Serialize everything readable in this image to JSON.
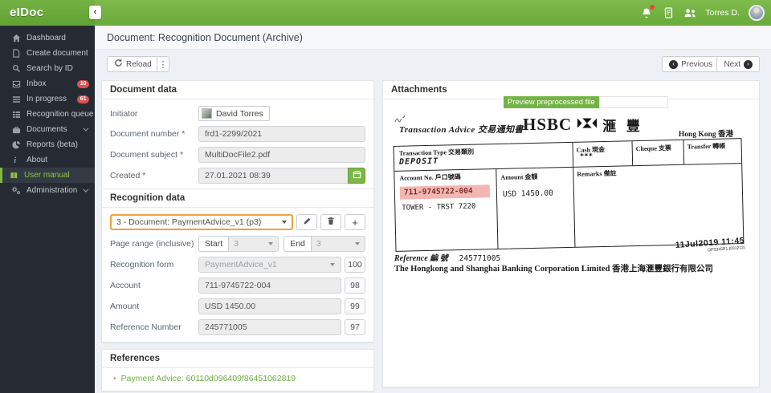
{
  "app": {
    "logo": "eIDoc"
  },
  "topbar": {
    "user_name": "Torres D."
  },
  "sidebar": {
    "items": [
      {
        "label": "Dashboard"
      },
      {
        "label": "Create document"
      },
      {
        "label": "Search by ID"
      },
      {
        "label": "Inbox",
        "badge": "10"
      },
      {
        "label": "In progress",
        "badge": "61"
      },
      {
        "label": "Recognition queue"
      },
      {
        "label": "Documents"
      },
      {
        "label": "Reports (beta)"
      },
      {
        "label": "About"
      },
      {
        "label": "User manual"
      },
      {
        "label": "Administration"
      }
    ]
  },
  "page": {
    "title": "Document: Recognition Document (Archive)"
  },
  "toolbar": {
    "reload_label": "Reload",
    "previous_label": "Previous",
    "next_label": "Next"
  },
  "document_data": {
    "title": "Document data",
    "initiator_label": "Initiator",
    "initiator_value": "David Torres",
    "document_number_label": "Document number *",
    "document_number_value": "frd1-2299/2021",
    "document_subject_label": "Document subject *",
    "document_subject_value": "MultiDocFile2.pdf",
    "created_label": "Created *",
    "created_value": "27.01.2021 08:39"
  },
  "recognition_data": {
    "title": "Recognition data",
    "selected_document": "3 - Document: PaymentAdvice_v1 (p3)",
    "page_range_label": "Page range (inclusive)",
    "start_label": "Start",
    "start_value": "3",
    "end_label": "End",
    "end_value": "3",
    "rows": [
      {
        "label": "Recognition form",
        "value": "PaymentAdvice_v1",
        "score": "100"
      },
      {
        "label": "Account",
        "value": "711-9745722-004",
        "score": "98"
      },
      {
        "label": "Amount",
        "value": "USD 1450.00",
        "score": "99"
      },
      {
        "label": "Reference Number",
        "value": "245771005",
        "score": "97"
      }
    ]
  },
  "references": {
    "title": "References",
    "link_label": "Payment Advice: 60110d096409f86451062819"
  },
  "attachments": {
    "title": "Attachments",
    "preview_button_label": "Preview preprocessed file",
    "scan": {
      "title": "Transaction Advice 交易通知書",
      "brand_latin": "HSBC",
      "brand_cjk": "滙 豐",
      "region": "Hong Kong 香港",
      "transaction_type_label": "Transaction Type 交易類別",
      "transaction_type_value": "DEPOSIT",
      "cash_label": "Cash 現金",
      "cash_value": "***",
      "cheque_label": "Cheque 支票",
      "transfer_label": "Transfer 轉帳",
      "account_label": "Account No. 戶口號碼",
      "account_value": "711-9745722-004",
      "account_value_2": "TOWER - TRST 7220",
      "amount_label": "Amount 金額",
      "amount_value": "USD 1450.00",
      "remarks_label": "Remarks 備註",
      "reference_label": "Reference 編 號",
      "reference_value": "245771005",
      "bank_name": "The Hongkong and Shanghai Banking Corporation Limited 香港上海滙豐銀行有限公司",
      "stamp_datetime": "11Jul2019 11:45",
      "stamp_code": "OPS345R1 (031212)"
    }
  },
  "colors": {
    "accent_green": "#74b445",
    "badge_red": "#d9534f",
    "selector_orange": "#f0a23c",
    "link_green": "#6fac47",
    "highlight_pink": "#f3b7b3"
  }
}
